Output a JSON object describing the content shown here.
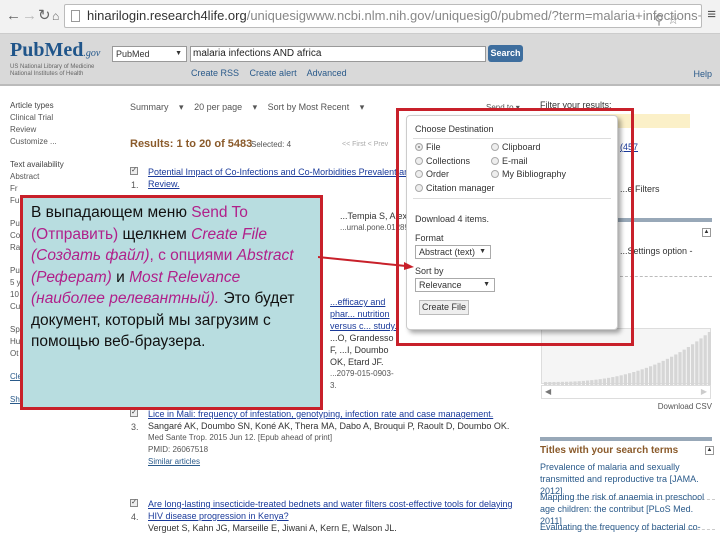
{
  "browser": {
    "url_host": "hinarilogin.research4life.org",
    "url_rest": "/uniquesigwww.ncbi.nlm.nih.gov/uniquesig0/pubmed/?term=malaria+infections+AND",
    "icons": [
      "back-arrow-icon",
      "forward-arrow-icon",
      "reload-icon",
      "home-icon",
      "page-icon",
      "zoom-icon",
      "star-icon",
      "menu-icon"
    ]
  },
  "header": {
    "logo_main": "PubMed",
    "logo_suffix": ".gov",
    "logo_sub1": "US National Library of Medicine",
    "logo_sub2": "National Institutes of Health",
    "database": "PubMed",
    "search_value": "malaria infections AND africa",
    "search_button": "Search",
    "links": [
      "Create RSS",
      "Create alert",
      "Advanced"
    ],
    "help": "Help"
  },
  "left_filters": {
    "article_types_title": "Article types",
    "article_types": [
      "Clinical Trial",
      "Review",
      "Customize ..."
    ],
    "text_availability_title": "Text availability",
    "text_availability": [
      "Abstract",
      "Fr",
      "Fu"
    ],
    "group3": [
      "Pu",
      "Co",
      "Ra"
    ],
    "group4": [
      "Pu",
      "5 y",
      "10",
      "Cu"
    ],
    "group5": [
      "Sp",
      "Hu",
      "Ot"
    ],
    "clear_all": "Clear all",
    "show_additional": "Show additional filters"
  },
  "toolbar": {
    "format": "Summary",
    "per_page": "20 per page",
    "sort": "Sort by Most Recent",
    "send_to": "Send to"
  },
  "results": {
    "summary": "Results: 1 to 20 of 5483",
    "selected": "Selected: 4",
    "pager": "<< First  < Prev"
  },
  "articles": [
    {
      "num": "1.",
      "title": "Potential Impact of Co-Infections and Co-Morbidities Prevalent and Frequency: A Systematic Review.",
      "authors": "...Tempia S, Alexan...",
      "meta": "...urnal.pone.01289..."
    },
    {
      "num": "2.",
      "title_frag": "...efficacy and phar... nutrition versus c... study.",
      "authors": "...O, Grandesso F, ...I, Doumbo OK, Etard JF.",
      "meta": "...2079-015-0903-3."
    },
    {
      "num": "3.",
      "title": "Lice in Mali: frequency of infestation, genotyping, infection rate and case management.",
      "authors": "Sangaré AK, Doumbo SN, Koné AK, Thera MA, Dabo A, Brouqui P, Raoult D, Doumbo OK.",
      "meta": "Med Sante Trop. 2015 Jun 12. [Epub ahead of print]",
      "pmid": "PMID: 26067518",
      "similar": "Similar articles"
    },
    {
      "num": "4.",
      "title": "Are long-lasting insecticide-treated bednets and water filters cost-effective tools for delaying HIV disease progression in Kenya?",
      "authors": "Verguet S, Kahn JG, Marseille E, Jiwani A, Kern E, Walson JL."
    }
  ],
  "send_to_dialog": {
    "heading": "Choose Destination",
    "destinations": [
      {
        "label": "File",
        "selected": true
      },
      {
        "label": "Clipboard",
        "selected": false
      },
      {
        "label": "Collections",
        "selected": false
      },
      {
        "label": "E-mail",
        "selected": false
      },
      {
        "label": "Order",
        "selected": false
      },
      {
        "label": "My Bibliography",
        "selected": false
      },
      {
        "label": "Citation manager",
        "selected": false
      }
    ],
    "download_text": "Download 4 items.",
    "format_label": "Format",
    "format_value": "Abstract (text)",
    "sort_label": "Sort by",
    "sort_value": "Relevance",
    "create_button": "Create File"
  },
  "right_panel": {
    "filter_heading": "Filter your results:",
    "count_frag": "(457",
    "manage_filters": "...e Filters",
    "settings_frag": "...Settings option -",
    "download_csv": "Download CSV",
    "titles_heading": "Titles with your search terms",
    "titles": [
      {
        "text": "Prevalence of malaria and sexually transmitted and reproductive tra",
        "source": "[JAMA. 2012]"
      },
      {
        "text": "Mapping the risk of anaemia in preschool age children: the contribut",
        "source": "[PLoS Med. 2011]"
      },
      {
        "text": "Evaluating the frequency of bacterial co-",
        "source": ""
      }
    ]
  },
  "callout": {
    "p1": "В выпадающем меню ",
    "send_to": "Send To (Отправить)",
    "p2": " щелкнем ",
    "create_file": "Create File (Создать файл)",
    "p3": ", с опциями ",
    "abstract": "Abstract (Реферат)",
    "p4": " и ",
    "most_relevance": "Most Relevance (наиболее релевантный).",
    "p5": "  Это будет документ, который мы загрузим с помощью веб-браузера."
  },
  "colors": {
    "accent_red": "#c8202a",
    "callout_bg": "#b8dde0",
    "callout_highlight": "#b0208a",
    "link_blue": "#1a3a9a",
    "results_brown": "#8a5a2a",
    "search_button": "#3e6e9e"
  }
}
